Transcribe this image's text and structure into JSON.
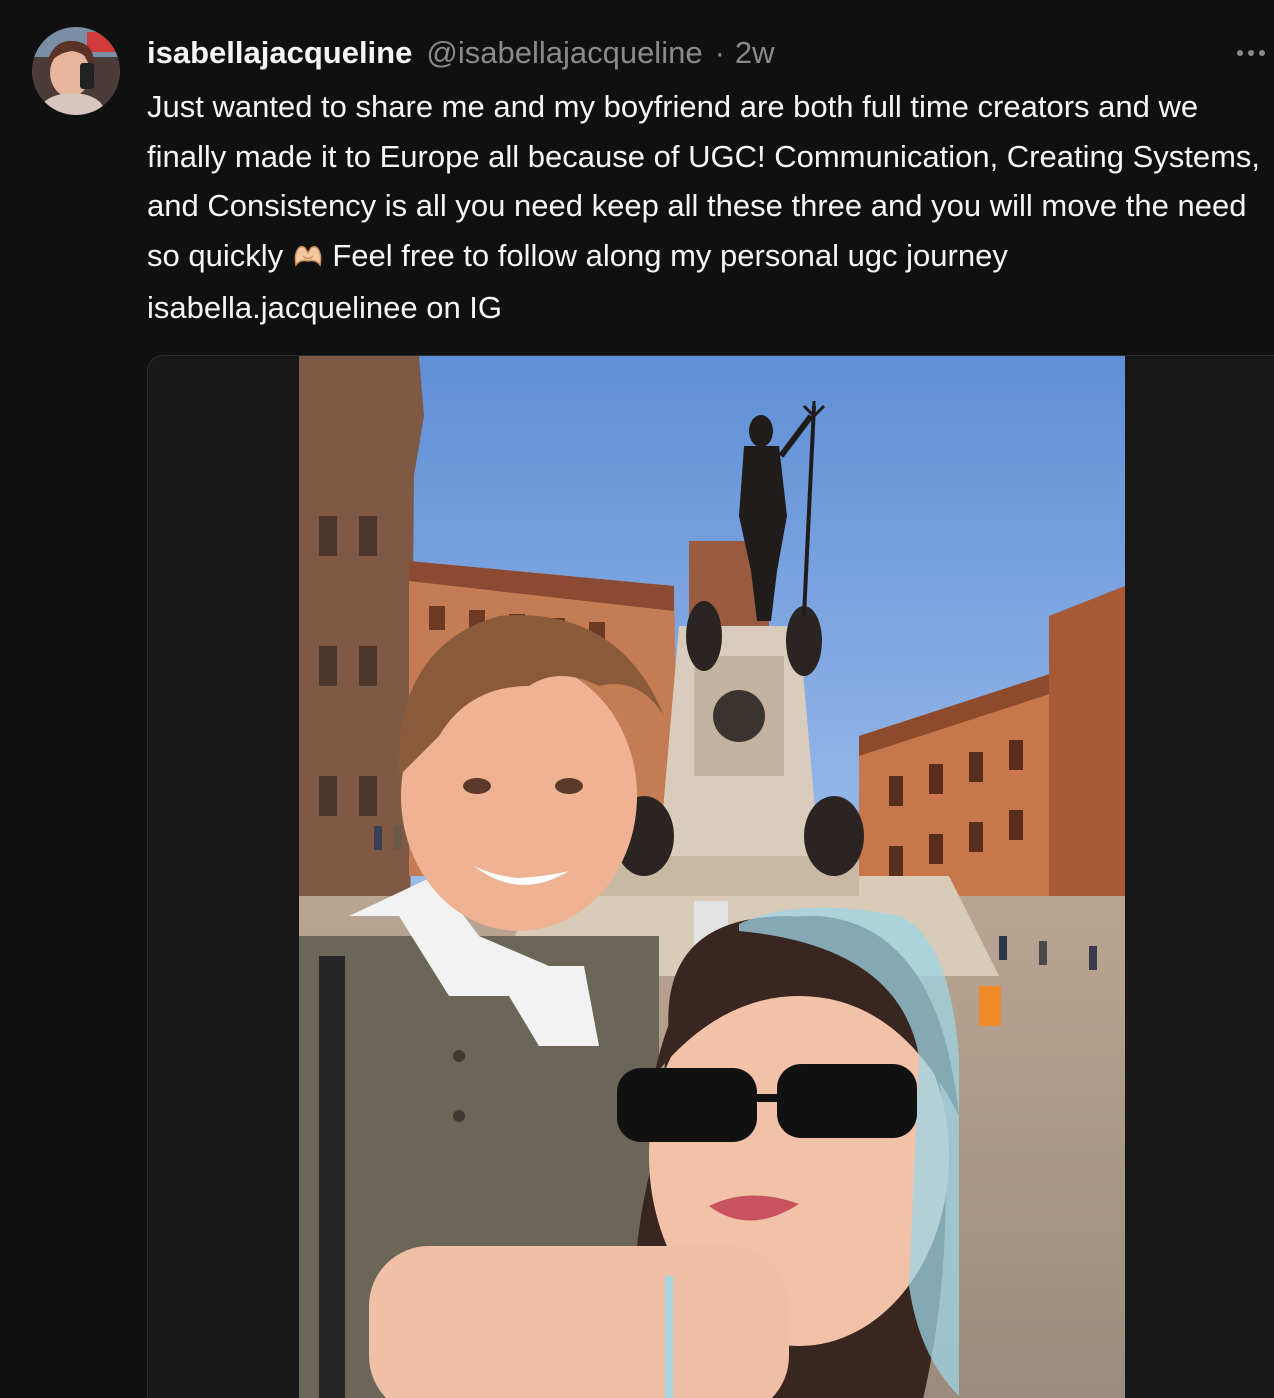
{
  "post": {
    "username": "isabellajacqueline",
    "handle": "@isabellajacqueline",
    "separator": "·",
    "time": "2w",
    "more_label": "···",
    "caption_part1": "Just wanted to share me and my boyfriend are both full time creators and we finally made it to Europe all because of UGC! Communication, Creating Systems, and Consistency is all you need keep all these three and you will move the need so quickly",
    "caption_part2": "Feel free to follow along my personal ugc journey isabella.jacquelinee on IG",
    "emoji_icon": "heart-hands-icon"
  },
  "media": {
    "type": "photo",
    "subject": "selfie-at-neptune-fountain"
  },
  "colors": {
    "background": "#101010",
    "text_primary": "#f3f5f7",
    "text_secondary": "#8a8a8a",
    "media_border": "#2c2c2c"
  }
}
